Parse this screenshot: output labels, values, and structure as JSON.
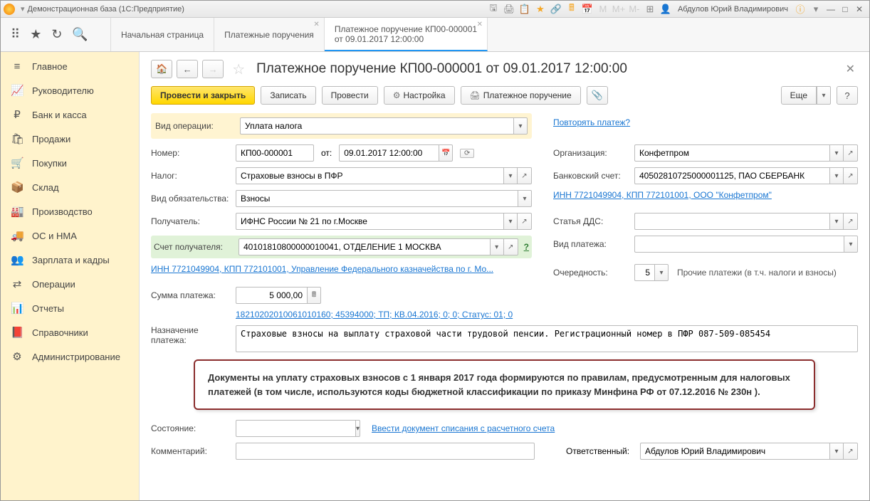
{
  "titlebar": {
    "app": "Демонстрационная база  (1С:Предприятие)",
    "user": "Абдулов Юрий Владимирович"
  },
  "tabs": {
    "t1": "Начальная страница",
    "t2": "Платежные поручения",
    "t3_l1": "Платежное поручение КП00-000001",
    "t3_l2": "от 09.01.2017 12:00:00"
  },
  "sidebar": {
    "main": "Главное",
    "mgr": "Руководителю",
    "bank": "Банк и касса",
    "sales": "Продажи",
    "buy": "Покупки",
    "stock": "Склад",
    "prod": "Производство",
    "os": "ОС и НМА",
    "salary": "Зарплата и кадры",
    "ops": "Операции",
    "reports": "Отчеты",
    "ref": "Справочники",
    "admin": "Администрирование"
  },
  "doc": {
    "title": "Платежное поручение КП00-000001 от 09.01.2017 12:00:00",
    "btn_save_close": "Провести и закрыть",
    "btn_write": "Записать",
    "btn_post": "Провести",
    "btn_settings": "Настройка",
    "btn_print": "Платежное поручение",
    "btn_more": "Еще",
    "repeat_link": "Повторять платеж?",
    "lbl_optype": "Вид операции:",
    "optype": "Уплата налога",
    "lbl_num": "Номер:",
    "num": "КП00-000001",
    "lbl_from": "от:",
    "date": "09.01.2017 12:00:00",
    "lbl_org": "Организация:",
    "org": "Конфетпром",
    "lbl_tax": "Налог:",
    "tax": "Страховые взносы в ПФР",
    "lbl_bank": "Банковский счет:",
    "bank": "40502810725000001125, ПАО СБЕРБАНК",
    "lbl_obl": "Вид обязательства:",
    "obl": "Взносы",
    "org_link": "ИНН 7721049904, КПП 772101001, ООО \"Конфетпром\"",
    "lbl_recv": "Получатель:",
    "recv": "ИФНС России № 21 по г.Москве",
    "lbl_dds": "Статья ДДС:",
    "dds": "",
    "lbl_recv_acc": "Счет получателя:",
    "recv_acc": "40101810800000010041, ОТДЕЛЕНИЕ 1 МОСКВА",
    "lbl_ptype": "Вид платежа:",
    "ptype": "",
    "recv_link": "ИНН 7721049904, КПП 772101001, Управление Федерального казначейства по г. Мо...",
    "lbl_order": "Очередность:",
    "order": "5",
    "order_txt": "Прочие платежи (в т.ч. налоги и взносы)",
    "lbl_sum": "Сумма платежа:",
    "sum": "5 000,00",
    "kbk_link": "18210202010061010160; 45394000; ТП; КВ.04.2016; 0; 0; Статус: 01; 0",
    "lbl_purpose": "Назначение платежа:",
    "purpose": "Страховые взносы на выплату страховой части трудовой пенсии. Регистрационный номер в ПФР 087-509-085454",
    "note": "Документы на уплату страховых взносов с 1 января 2017 года формируются по правилам, предусмотренным для налоговых платежей (в том числе, используются коды бюджетной классификации по приказу Минфина РФ от 07.12.2016 № 230н ).",
    "lbl_state": "Состояние:",
    "state": "",
    "state_link": "Ввести документ списания с расчетного счета",
    "lbl_comment": "Комментарий:",
    "comment": "",
    "lbl_resp": "Ответственный:",
    "resp": "Абдулов Юрий Владимирович"
  }
}
